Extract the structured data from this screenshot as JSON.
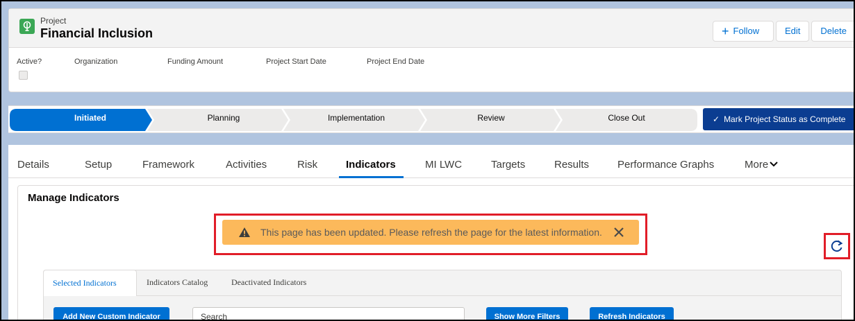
{
  "record": {
    "object_type": "Project",
    "name": "Financial Inclusion",
    "icon": "lightbulb-icon",
    "icon_color": "#3ba755"
  },
  "header_actions": {
    "follow": "Follow",
    "edit": "Edit",
    "delete": "Delete"
  },
  "highlights": {
    "active": "Active?",
    "organization": "Organization",
    "funding_amount": "Funding Amount",
    "start_date": "Project Start Date",
    "end_date": "Project End Date"
  },
  "path": {
    "stages": [
      "Initiated",
      "Planning",
      "Implementation",
      "Review",
      "Close Out"
    ],
    "active_stage": "Initiated",
    "mark_complete": "Mark Project Status as Complete",
    "active_color": "#0070d2"
  },
  "tabs": {
    "items": [
      "Details",
      "Setup",
      "Framework",
      "Activities",
      "Risk",
      "Indicators",
      "MI LWC",
      "Targets",
      "Results",
      "Performance Graphs",
      "More"
    ],
    "active": "Indicators"
  },
  "manage": {
    "title": "Manage Indicators",
    "toast_message": "This page has been updated. Please refresh the page for the latest information.",
    "toast_color": "#fcb95b",
    "highlight_color": "#e11d28"
  },
  "subtabs": {
    "selected": "Selected Indicators",
    "catalog": "Indicators Catalog",
    "deactivated": "Deactivated Indicators"
  },
  "actions": {
    "add_custom": "Add New Custom Indicator",
    "search_placeholder": "Search",
    "show_filters": "Show More Filters",
    "refresh": "Refresh Indicators"
  }
}
